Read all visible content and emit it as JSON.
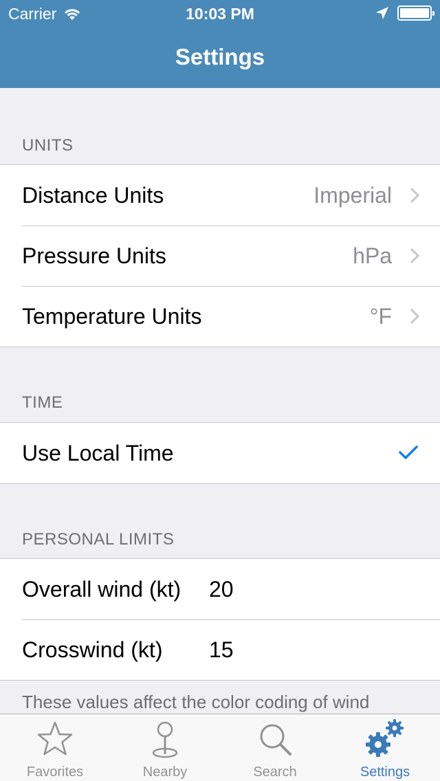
{
  "status_bar": {
    "carrier": "Carrier",
    "time": "10:03 PM"
  },
  "nav": {
    "title": "Settings"
  },
  "units": {
    "header": "UNITS",
    "rows": [
      {
        "label": "Distance Units",
        "value": "Imperial"
      },
      {
        "label": "Pressure Units",
        "value": "hPa"
      },
      {
        "label": "Temperature Units",
        "value": "°F"
      }
    ]
  },
  "time": {
    "header": "TIME",
    "rows": [
      {
        "label": "Use Local Time",
        "checked": true
      }
    ]
  },
  "personal_limits": {
    "header": "PERSONAL LIMITS",
    "rows": [
      {
        "label": "Overall wind (kt)",
        "value": "20"
      },
      {
        "label": "Crosswind (kt)",
        "value": "15"
      }
    ],
    "footer": "These values affect the color coding of wind"
  },
  "tabbar": {
    "tabs": [
      {
        "label": "Favorites",
        "icon": "star-icon"
      },
      {
        "label": "Nearby",
        "icon": "location-pin-icon"
      },
      {
        "label": "Search",
        "icon": "search-icon"
      },
      {
        "label": "Settings",
        "icon": "gears-icon",
        "active": true
      }
    ]
  },
  "colors": {
    "nav_bar": "#4a8ab9",
    "accent": "#3b7ab8",
    "checkmark": "#1a7cf5"
  }
}
